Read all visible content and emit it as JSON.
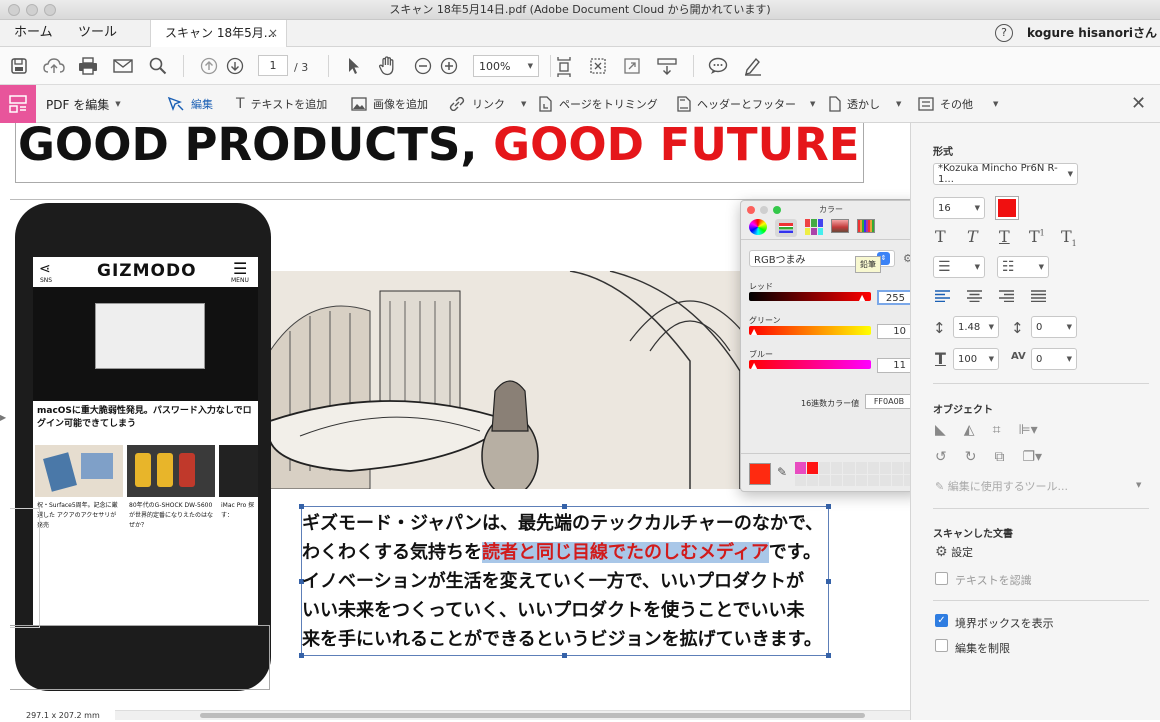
{
  "window": {
    "title": "スキャン 18年5月14日.pdf (Adobe Document Cloud から開かれています)"
  },
  "tabs": {
    "home": "ホーム",
    "tools": "ツール",
    "doc_tab": "スキャン 18年5月...",
    "close": "×"
  },
  "user": {
    "name": "kogure hisanoriさん",
    "help": "?"
  },
  "toolbar": {
    "page_current": "1",
    "page_total": "/ 3",
    "zoom": "100%"
  },
  "edit_toolbar": {
    "mode_label": "PDF を編集",
    "edit": "編集",
    "add_text": "テキストを追加",
    "add_image": "画像を追加",
    "link": "リンク",
    "crop": "ページをトリミング",
    "header_footer": "ヘッダーとフッター",
    "watermark": "透かし",
    "more": "その他"
  },
  "document": {
    "headline_black": "GOOD PRODUCTS, ",
    "headline_red": "GOOD FUTURE",
    "phone_logo": "GIZMODO",
    "phone_sns": "SNS",
    "phone_menu": "MENU",
    "phone_article": "macOSに重大脆弱性発見。パスワード入力なしでログイン可能できてしまう",
    "phone_card1": "祝・Surface5周年。記念に厳選した アクアのアクセサリが発売",
    "phone_card2": "80年代のG-SHOCK DW-5600が世界的定番になりえたのはなぜか？",
    "phone_card3": "iMac Pro 探す：",
    "body_line1": "ギズモード・ジャパンは、最先端のテックカルチャーのなかで、",
    "body_line2a": "わくわくする気持ちを",
    "body_line2b": "読者と同じ目線でたのしむメディア",
    "body_line2c": "です。",
    "body_line3": "イノベーションが生活を変えていく一方で、いいプロダクトが",
    "body_line4": "いい未来をつくっていく、いいプロダクトを使うことでいい未",
    "body_line5": "来を手にいれることができるというビジョンを拡げていきます。"
  },
  "color_palette": {
    "title": "カラー",
    "mode": "RGBつまみ",
    "tooltip": "鉛筆",
    "red_label": "レッド",
    "red_value": "255",
    "green_label": "グリーン",
    "green_value": "10",
    "blue_label": "ブルー",
    "blue_value": "11",
    "hex_label": "16進数カラー値",
    "hex_value": "FF0A0B",
    "current_color": "#FF0A0B"
  },
  "right_panel": {
    "format_heading": "形式",
    "font_name": "*Kozuka Mincho Pr6N R-1...",
    "font_size": "16",
    "text_color": "#F01010",
    "line_spacing": "1.48",
    "para_spacing": "0",
    "h_scale": "100",
    "char_spacing": "0",
    "object_heading": "オブジェクト",
    "edit_tool": "編集に使用するツール...",
    "scanned_heading": "スキャンした文書",
    "settings": "設定",
    "recognize_text": "テキストを認識",
    "show_bbox": "境界ボックスを表示",
    "restrict_edit": "編集を制限"
  },
  "status": {
    "page_size": "297.1 x 207.2 mm"
  }
}
